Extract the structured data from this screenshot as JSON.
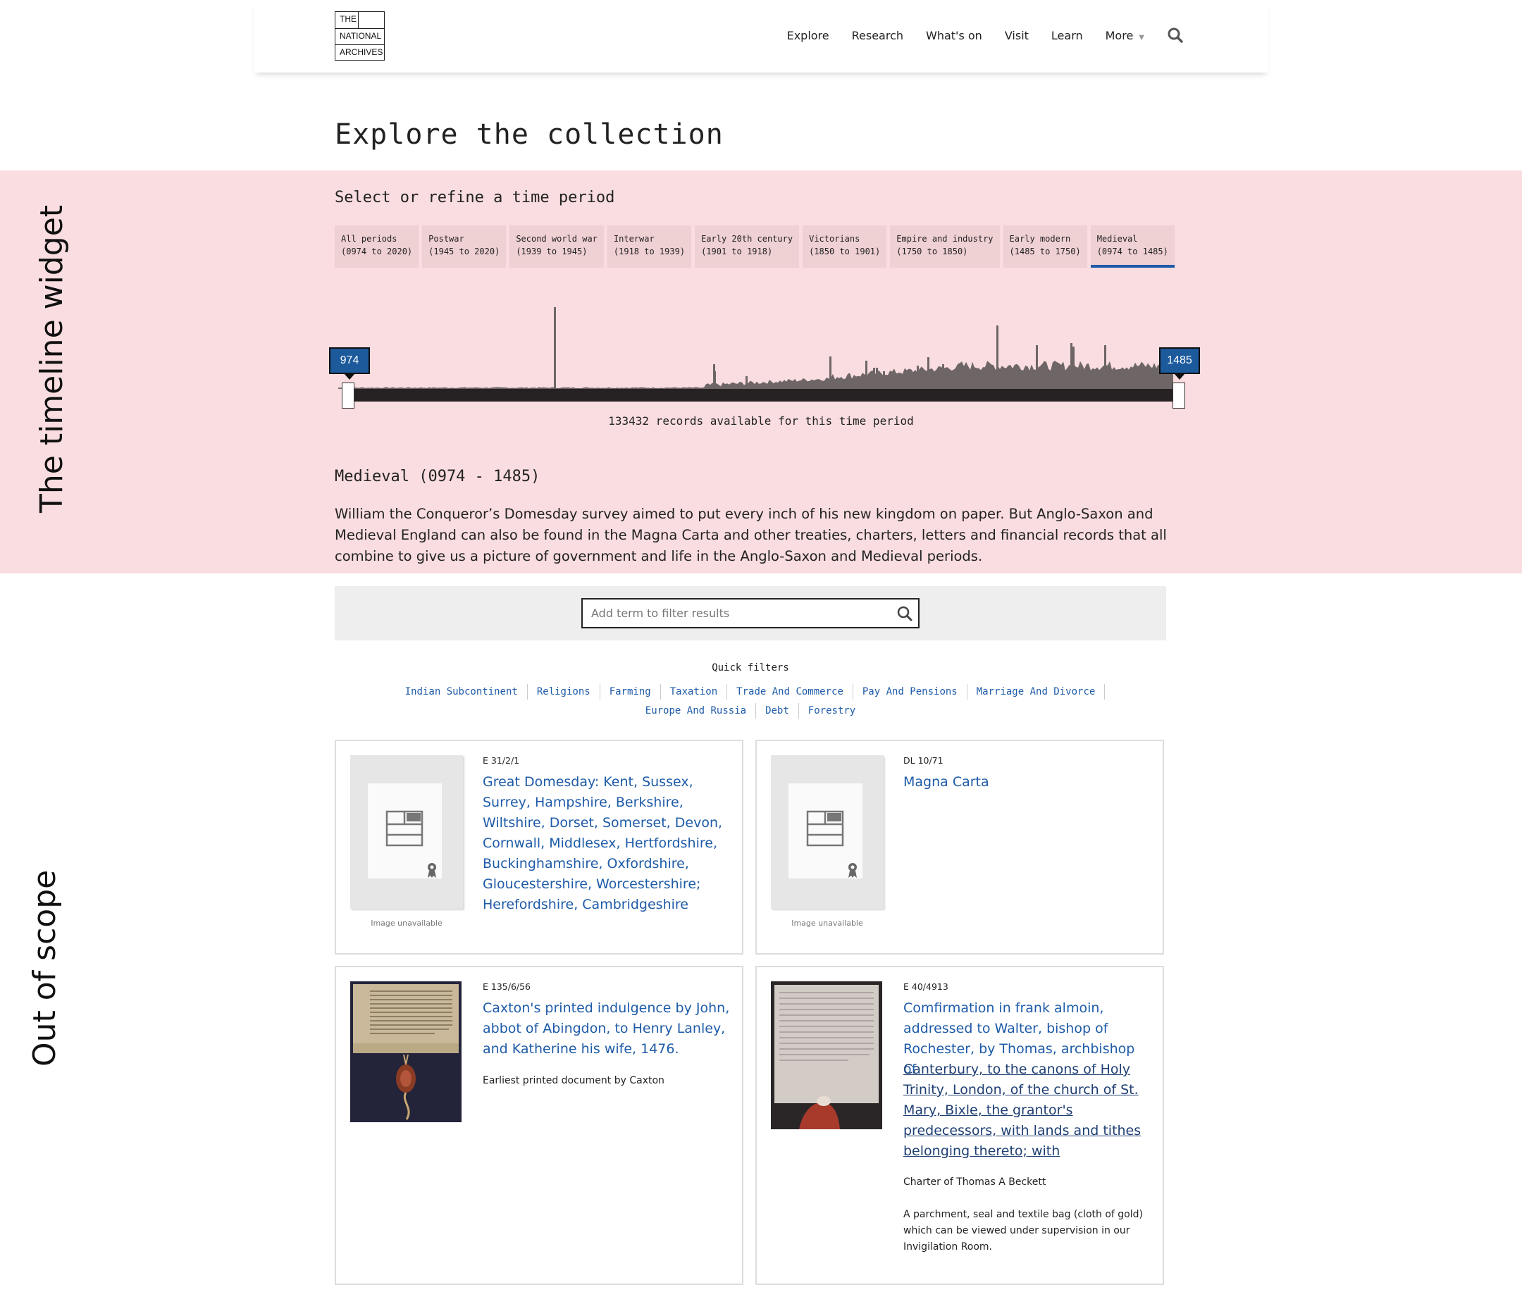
{
  "header": {
    "logo": [
      "THE",
      "NATIONAL",
      "ARCHIVES"
    ],
    "nav": [
      "Explore",
      "Research",
      "What's on",
      "Visit",
      "Learn",
      "More"
    ]
  },
  "page_title": "Explore the collection",
  "annotations": {
    "timeline": "The timeline widget",
    "out_of_scope": "Out of scope"
  },
  "timeline": {
    "heading": "Select or refine a time period",
    "tabs": [
      {
        "name": "All periods",
        "range": "(0974 to 2020)"
      },
      {
        "name": "Postwar",
        "range": "(1945 to 2020)"
      },
      {
        "name": "Second world war",
        "range": "(1939 to 1945)"
      },
      {
        "name": "Interwar",
        "range": "(1918 to 1939)"
      },
      {
        "name": "Early 20th century",
        "range": "(1901 to 1918)"
      },
      {
        "name": "Victorians",
        "range": "(1850 to 1901)"
      },
      {
        "name": "Empire and industry",
        "range": "(1750 to 1850)"
      },
      {
        "name": "Early modern",
        "range": "(1485 to 1750)"
      },
      {
        "name": "Medieval",
        "range": "(0974 to 1485)"
      }
    ],
    "active_tab": 8,
    "range_start": "974",
    "range_end": "1485",
    "records_text": "133432 records available for this time period",
    "period_title": "Medieval (0974 - 1485)",
    "period_description": "William the Conqueror’s Domesday survey aimed to put every inch of his new kingdom on paper. But Anglo-Saxon and Medieval England can also be found in the Magna Carta and other treaties, charters, letters and financial records that all combine to give us a picture of government and life in the Anglo-Saxon and Medieval periods."
  },
  "filter": {
    "placeholder": "Add term to filter results",
    "quick_filters_heading": "Quick filters",
    "quick_filters_row1": [
      "Indian Subcontinent",
      "Religions",
      "Farming",
      "Taxation",
      "Trade And Commerce",
      "Pay And Pensions",
      "Marriage And Divorce"
    ],
    "quick_filters_row2": [
      "Europe And Russia",
      "Debt",
      "Forestry"
    ]
  },
  "results": [
    {
      "ref": "E 31/2/1",
      "title": "Great Domesday: Kent, Sussex, Surrey, Hampshire, Berkshire, Wiltshire, Dorset, Somerset, Devon, Cornwall, Middlesex, Hertfordshire, Buckinghamshire, Oxfordshire, Gloucestershire, Worcestershire; Herefordshire, Cambridgeshire",
      "image_note": "Image unavailable"
    },
    {
      "ref": "DL 10/71",
      "title": "Magna Carta",
      "image_note": "Image unavailable"
    },
    {
      "ref": "E 135/6/56",
      "title": "Caxton's printed indulgence by John, abbot of Abingdon, to Henry Lanley, and Katherine his wife, 1476.",
      "desc1": "Earliest printed document by Caxton"
    },
    {
      "ref": "E 40/4913",
      "title": "Comfirmation in frank almoin, addressed to Walter, bishop of Rochester, by Thomas, archbishop of",
      "title_underlined": "Canterbury, to the canons of Holy Trinity, London, of the church of St. Mary, Bixle, the grantor's predecessors, with lands and tithes belonging thereto; with",
      "desc1": "Charter of Thomas A Beckett",
      "desc2": "A parchment, seal and textile bag (cloth of gold) which can be viewed under supervision in our Invigilation Room."
    }
  ],
  "colors": {
    "band": "#f9dde0",
    "tab": "#efd0d3",
    "accent": "#1e5ba8",
    "histogram": "#6e6666"
  },
  "icons": [
    "search-icon",
    "document-placeholder-icon",
    "award-ribbon-icon"
  ]
}
